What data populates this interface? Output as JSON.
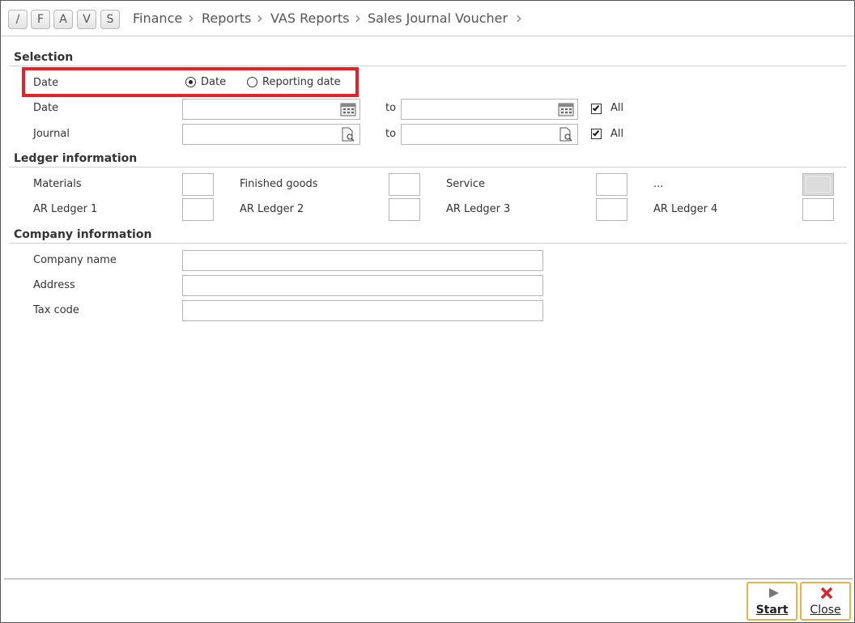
{
  "nav": {
    "quick_buttons": [
      "/",
      "F",
      "A",
      "V",
      "S"
    ],
    "breadcrumb": [
      "Finance",
      "Reports",
      "VAS Reports",
      "Sales Journal Voucher"
    ]
  },
  "selection": {
    "title": "Selection",
    "date_type_label": "Date",
    "radio_date": "Date",
    "radio_reporting_date": "Reporting date",
    "selected_radio": "Date",
    "date_label": "Date",
    "journal_label": "Journal",
    "to_label": "to",
    "all_label": "All",
    "date_all_checked": true,
    "journal_all_checked": true
  },
  "ledger": {
    "title": "Ledger information",
    "items": [
      "Materials",
      "Finished goods",
      "Service",
      "...",
      "AR Ledger 1",
      "AR Ledger 2",
      "AR Ledger 3",
      "AR Ledger 4"
    ]
  },
  "company": {
    "title": "Company information",
    "name_label": "Company name",
    "address_label": "Address",
    "tax_code_label": "Tax code"
  },
  "actions": {
    "start": "Start",
    "close": "Close"
  },
  "colors": {
    "highlight": "#e8202a",
    "button_border": "#e9b24a",
    "close_icon": "#d9262b"
  }
}
